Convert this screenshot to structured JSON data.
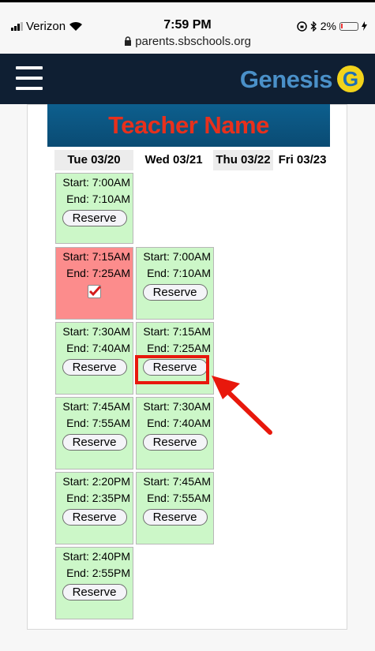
{
  "status_bar": {
    "carrier": "Verizon",
    "time": "7:59 PM",
    "url": "parents.sbschools.org",
    "battery": "2%",
    "signal_icon": "signal-bars-icon",
    "wifi_icon": "wifi-icon",
    "lock_icon": "lock-icon",
    "bluetooth_icon": "bluetooth-icon",
    "rotation_lock_icon": "rotation-lock-icon",
    "battery_icon": "battery-icon",
    "charging_icon": "charging-bolt-icon"
  },
  "app_header": {
    "brand": "Genesis",
    "logo_letter": "G",
    "menu_icon": "hamburger-menu-icon",
    "colors": {
      "background": "#0f1f33",
      "brand": "#4a90c8",
      "logo": "#f2d31b"
    }
  },
  "schedule": {
    "teacher_name": "Teacher Name",
    "days": [
      "Tue 03/20",
      "Wed 03/21",
      "Thu 03/22",
      "Fri 03/23"
    ],
    "reserve_label": "Reserve",
    "colors": {
      "available": "#ccf7c8",
      "booked": "#fc8c8c",
      "teacher_name": "#e8301c"
    },
    "tue": [
      {
        "start": "Start: 7:00AM",
        "end": "End: 7:10AM",
        "status": "available"
      },
      {
        "start": "Start: 7:15AM",
        "end": "End: 7:25AM",
        "status": "booked"
      },
      {
        "start": "Start: 7:30AM",
        "end": "End: 7:40AM",
        "status": "available"
      },
      {
        "start": "Start: 7:45AM",
        "end": "End: 7:55AM",
        "status": "available"
      },
      {
        "start": "Start: 2:20PM",
        "end": "End: 2:35PM",
        "status": "available"
      },
      {
        "start": "Start: 2:40PM",
        "end": "End: 2:55PM",
        "status": "available"
      }
    ],
    "wed": [
      {
        "start": "Start: 7:00AM",
        "end": "End: 7:10AM",
        "status": "available"
      },
      {
        "start": "Start: 7:15AM",
        "end": "End: 7:25AM",
        "status": "available",
        "highlighted": true
      },
      {
        "start": "Start: 7:30AM",
        "end": "End: 7:40AM",
        "status": "available"
      },
      {
        "start": "Start: 7:45AM",
        "end": "End: 7:55AM",
        "status": "available"
      }
    ]
  },
  "annotation": {
    "color": "#e8180c",
    "arrow_icon": "red-arrow-icon"
  }
}
